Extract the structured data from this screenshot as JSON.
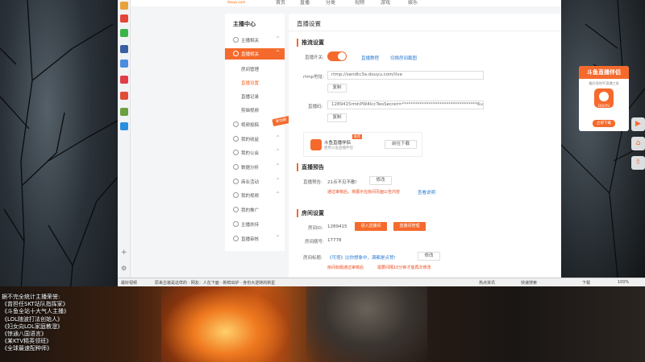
{
  "top_nav": {
    "logo": "douyu.com",
    "items": [
      "首页",
      "直播",
      "分类",
      "视频",
      "游戏",
      "娱乐"
    ]
  },
  "sidebar": {
    "title": "主播中心",
    "items": [
      {
        "label": "主播相关",
        "caret": "^"
      },
      {
        "label": "直播相关",
        "caret": "^",
        "active": true
      },
      {
        "label": "视频投稿",
        "caret": "^"
      },
      {
        "label": "我的收益",
        "caret": "^"
      },
      {
        "label": "我的公会",
        "caret": "^"
      },
      {
        "label": "数据分析",
        "caret": "^"
      },
      {
        "label": "商业活动",
        "caret": "^"
      },
      {
        "label": "我的视频",
        "caret": "^"
      },
      {
        "label": "我的推广",
        "caret": ""
      },
      {
        "label": "主播扶持",
        "caret": ""
      },
      {
        "label": "直播审核",
        "caret": "^"
      }
    ],
    "subitems": [
      {
        "label": "房间管理"
      },
      {
        "label": "直播设置",
        "active": true
      },
      {
        "label": "直播记录"
      },
      {
        "label": "剪辑视频"
      }
    ],
    "new_badge": "新功能"
  },
  "panel": {
    "title": "直播设置",
    "stream_section": {
      "title": "推流设置",
      "switch_label": "直播开关:",
      "switch_on": true,
      "link_tutorial": "直播教程",
      "link_switch": "切换房间截图",
      "rtmp_label": "rtmp地址:",
      "rtmp_value": "rtmp://sendtc3a.douyu.com/live",
      "copy_label": "复制",
      "code_label": "直播码:",
      "code_value": "1289415rmhPW4lccTwsSecret=**********************************6ues5l",
      "copy_label_2": "复制",
      "promo_title": "斗鱼直播伴侣",
      "promo_sub": "使用斗鱼直播伴侣",
      "promo_tag": "推荐",
      "promo_download": "前往下载"
    },
    "preview_section": {
      "title": "直播预告",
      "label": "直播预告:",
      "value": "21点不见不散!",
      "edit_label": "修改",
      "note": "通过审核后，将展示在房间页面公告内容",
      "note_link": "查看说明"
    },
    "room_section": {
      "title": "房间设置",
      "room_id_label": "房间ID:",
      "room_id_value": "1289415",
      "btn_enter": "进入直播间",
      "btn_manage": "直播间管理",
      "room_no_label": "房间靓号:",
      "room_no_value": "17778",
      "room_title_label": "房间标题:",
      "room_title_value": "《可塔》比你想象中，满都是点赞!",
      "edit_label": "修改",
      "title_note_1": "房间标题通过审核后",
      "title_note_2": "需要间隔10分钟才能再次修改"
    }
  },
  "float_ad": {
    "header": "斗鱼直播伴侣",
    "sub": "最好用的PC直播工具",
    "logo_text": "DOUYU",
    "button": "立即下载"
  },
  "status_bar": {
    "left_text": "最好视频",
    "news": "原来古装是这样的 · 网友：人在下面 · 新鲜出炉 · 身份大逆转的新星",
    "right_1": "热点资讯",
    "right_2": "快速搜索",
    "right_3": "下载",
    "right_4": "100%"
  },
  "overlay": {
    "lines": [
      "据不完全统计主播荣誉:",
      "《曾担任SKT站队指挥家》",
      "《斗鱼全站十大气人主播》",
      "《LOL随波打法创始人》",
      "《妇女向LOL家庭教澄》",
      "《惊通八国语言》",
      "《某KTV精英领班》",
      "《全球最速配种师》"
    ]
  },
  "colors": {
    "accent": "#f56a2c",
    "link": "#2a7ad5",
    "warn": "#e84a1c"
  }
}
